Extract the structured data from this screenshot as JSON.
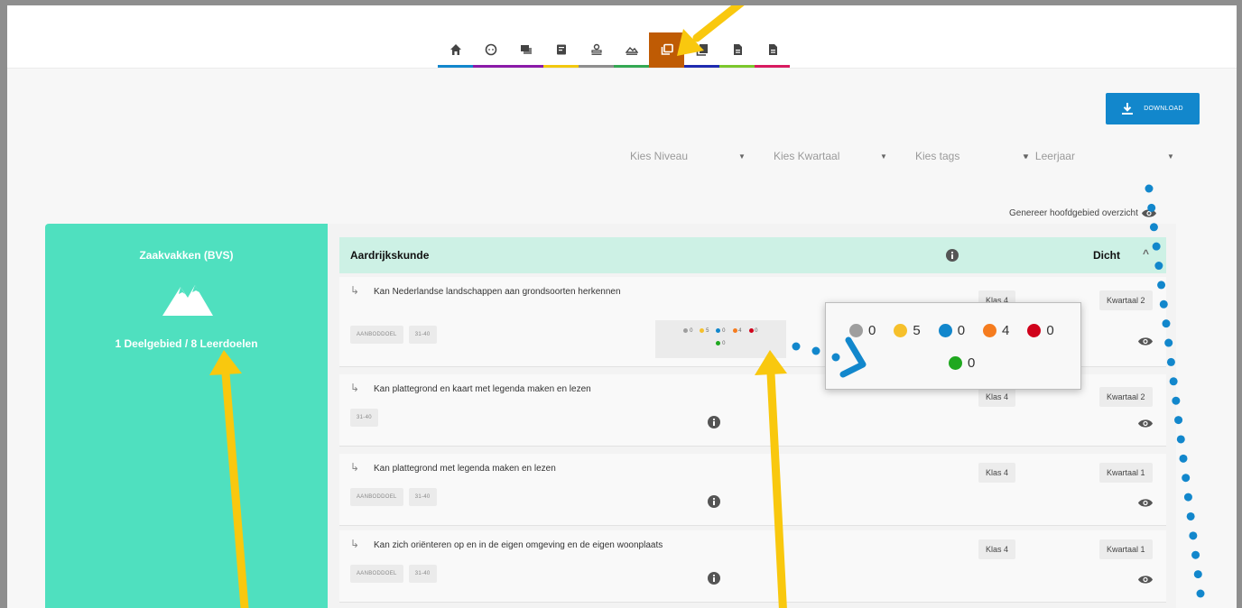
{
  "toolbar": {
    "nav_items": [
      {
        "icon": "home-icon",
        "bar": "#1287cc"
      },
      {
        "icon": "child-face-icon",
        "bar": "#8b1aa8"
      },
      {
        "icon": "chat-icon",
        "bar": "#8b1aa8"
      },
      {
        "icon": "note-icon",
        "bar": "#f2c80f"
      },
      {
        "icon": "stamp-icon",
        "bar": "#8e8e8e"
      },
      {
        "icon": "landscape-icon",
        "bar": "#34a853"
      },
      {
        "icon": "library-copy-icon",
        "bar": "#bf5b04",
        "active": true
      },
      {
        "icon": "book-stack-icon",
        "bar": "#1f2bb0"
      },
      {
        "icon": "document-icon",
        "bar": "#7cc72d"
      },
      {
        "icon": "document-icon",
        "bar": "#d81b60"
      }
    ],
    "download_label": "DOWNLOAD"
  },
  "filters": {
    "niveau": "Kies Niveau",
    "kwartaal": "Kies Kwartaal",
    "tags": "Kies tags",
    "leerjaar": "Leerjaar"
  },
  "genereer_label": "Genereer hoofdgebied overzicht",
  "sidebar": {
    "title": "Zaakvakken (BVS)",
    "count": "1 Deelgebied / 8 Leerdoelen"
  },
  "subject": {
    "name": "Aardrijkskunde",
    "status": "Dicht"
  },
  "rows": [
    {
      "text": "Kan Nederlandse landschappen aan grondsoorten herkennen",
      "tags": [
        "AANBODDOEL",
        "31-40"
      ],
      "klas": "Klas 4",
      "kwartaal": "Kwartaal 2"
    },
    {
      "text": "Kan plattegrond en kaart met legenda maken en lezen",
      "tags": [
        "31-40"
      ],
      "klas": "Klas 4",
      "kwartaal": "Kwartaal 2"
    },
    {
      "text": "Kan plattegrond met legenda maken en lezen",
      "tags": [
        "AANBODDOEL",
        "31-40"
      ],
      "klas": "Klas 4",
      "kwartaal": "Kwartaal 1"
    },
    {
      "text": "Kan zich oriënteren op en in de eigen omgeving en de eigen woonplaats",
      "tags": [
        "AANBODDOEL",
        "31-40"
      ],
      "klas": "Klas 4",
      "kwartaal": "Kwartaal 1"
    }
  ],
  "scores": [
    {
      "color": "#9e9e9e",
      "value": "0"
    },
    {
      "color": "#f6c02b",
      "value": "5"
    },
    {
      "color": "#1287cc",
      "value": "0"
    },
    {
      "color": "#f57c1f",
      "value": "4"
    },
    {
      "color": "#d0021b",
      "value": "0"
    },
    {
      "color": "#1fa81f",
      "value": "0"
    }
  ],
  "colors": {
    "sidebar": "#4fe0bf",
    "subject_bg": "#cdf1e5",
    "download": "#1287cc",
    "annotation_arrow": "#f9c80e",
    "annotation_dots": "#1287cc"
  }
}
